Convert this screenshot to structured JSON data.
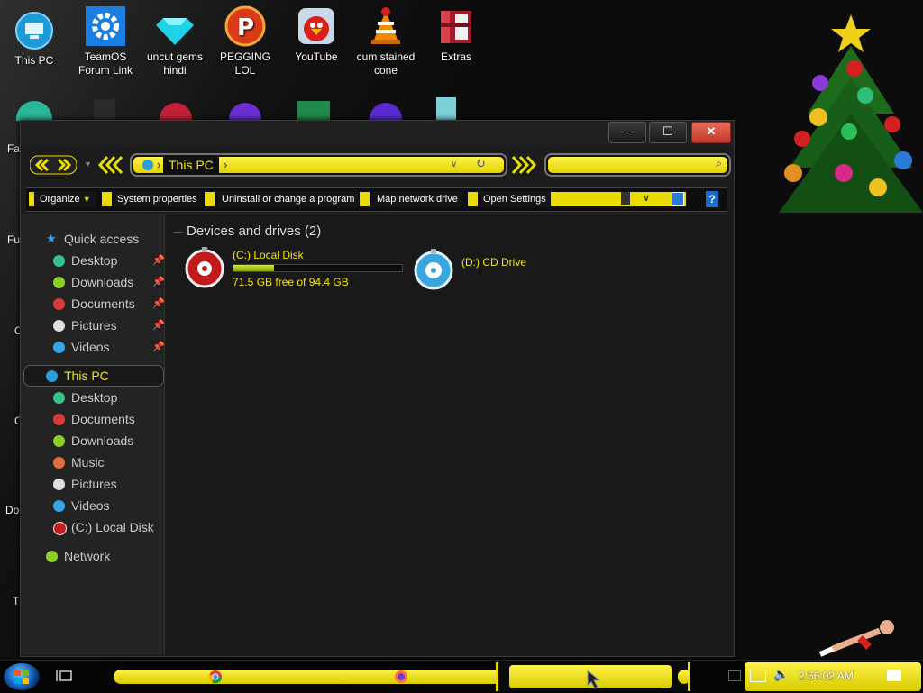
{
  "desktop": {
    "icons": [
      {
        "label": "This PC",
        "icon": "computer-icon"
      },
      {
        "label": "TeamOS Forum Link",
        "icon": "gear-icon"
      },
      {
        "label": "uncut gems hindi",
        "icon": "diamond-icon"
      },
      {
        "label": "PEGGING LOL",
        "icon": "pdf-app-icon"
      },
      {
        "label": "YouTube",
        "icon": "angry-bird-icon"
      },
      {
        "label": "cum stained cone",
        "icon": "vlc-cone-icon"
      },
      {
        "label": "Extras",
        "icon": "winrar-box-icon"
      }
    ],
    "partial_labels": [
      "Fal",
      "Fu",
      "C",
      "C E",
      "Do Fro",
      "T F"
    ]
  },
  "window": {
    "buttons": {
      "minimize": "—",
      "maximize": "☐",
      "close": "✕"
    },
    "address": {
      "location": "This PC",
      "sep": "›"
    },
    "search_placeholder": "",
    "commands": [
      "Organize",
      "System properties",
      "Uninstall or change a program",
      "Map network drive",
      "Open Settings"
    ],
    "help": "?"
  },
  "sidebar": {
    "quick_access": {
      "label": "Quick access",
      "items": [
        {
          "label": "Desktop",
          "color": "#36c28a"
        },
        {
          "label": "Downloads",
          "color": "#8ccf2b"
        },
        {
          "label": "Documents",
          "color": "#d93a3a"
        },
        {
          "label": "Pictures",
          "color": "#e0e0e0"
        },
        {
          "label": "Videos",
          "color": "#38a6e8"
        }
      ]
    },
    "this_pc": {
      "label": "This PC",
      "items": [
        {
          "label": "Desktop",
          "color": "#36c28a"
        },
        {
          "label": "Documents",
          "color": "#d93a3a"
        },
        {
          "label": "Downloads",
          "color": "#8ccf2b"
        },
        {
          "label": "Music",
          "color": "#e0703a"
        },
        {
          "label": "Pictures",
          "color": "#e0e0e0"
        },
        {
          "label": "Videos",
          "color": "#38a6e8"
        },
        {
          "label": "(C:) Local Disk",
          "color": "#c02020"
        }
      ]
    },
    "network": {
      "label": "Network"
    }
  },
  "content": {
    "group_title": "Devices and drives (2)",
    "drives": [
      {
        "name": "(C:) Local Disk",
        "free_text": "71.5 GB free of 94.4 GB",
        "used_fraction": 0.24
      },
      {
        "name": "(D:) CD Drive"
      }
    ]
  },
  "taskbar": {
    "clock": "2:56:02 AM"
  },
  "colors": {
    "accent": "#f5e800",
    "window_bg": "#1c1c1c"
  }
}
